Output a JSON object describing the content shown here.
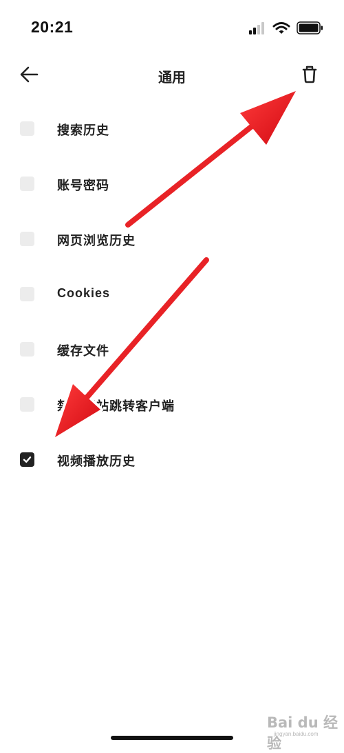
{
  "status_bar": {
    "time": "20:21",
    "icons": [
      "signal-icon",
      "wifi-icon",
      "battery-icon"
    ]
  },
  "nav": {
    "title": "通用",
    "back_icon": "arrow-left-icon",
    "delete_icon": "trash-icon"
  },
  "items": [
    {
      "label": "搜索历史",
      "checked": false
    },
    {
      "label": "账号密码",
      "checked": false
    },
    {
      "label": "网页浏览历史",
      "checked": false
    },
    {
      "label": "Cookies",
      "checked": false
    },
    {
      "label": "缓存文件",
      "checked": false
    },
    {
      "label": "禁止网站跳转客户端",
      "checked": false
    },
    {
      "label": "视频播放历史",
      "checked": true
    }
  ],
  "colors": {
    "checked": "#222222",
    "unchecked": "#ececec",
    "annotation_arrow": "#e5121b"
  },
  "watermark": {
    "text": "Bai du 经验",
    "url": "jingyan.baidu.com"
  }
}
